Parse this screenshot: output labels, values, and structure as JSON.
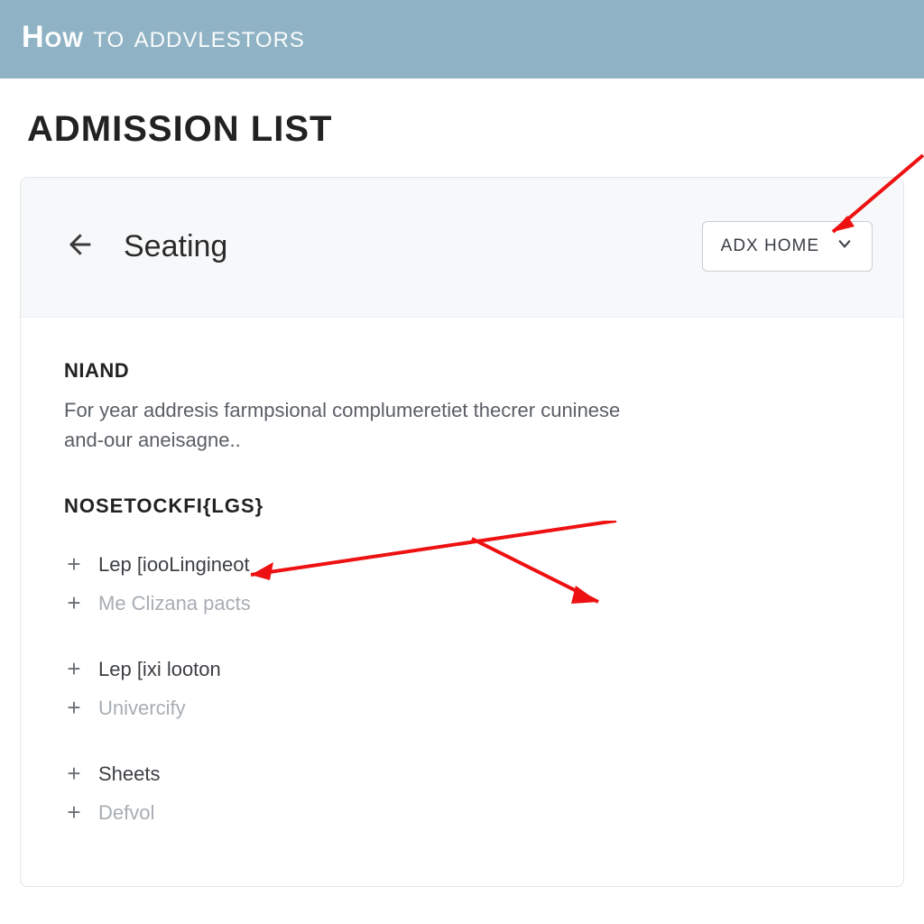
{
  "banner": {
    "lead": "How",
    "rest": " to addvlestors"
  },
  "page_title": "ADMISSION LIST",
  "card": {
    "back_icon": "arrow-left-icon",
    "title": "Seating",
    "dropdown": {
      "label": "ADX HOME",
      "chevron_icon": "chevron-down-icon"
    }
  },
  "section": {
    "label": "NIAND",
    "description": "For year addresis farmpsional complumeretiet thecrer cuninese and-our aneisagne..",
    "subheading": "NOSETOCKFI{LGS}"
  },
  "groups": [
    {
      "items": [
        {
          "label": "Lep [iooLingineot",
          "muted": false
        },
        {
          "label": "Me Clizana pacts",
          "muted": true
        }
      ]
    },
    {
      "items": [
        {
          "label": "Lep [ixi looton",
          "muted": false
        },
        {
          "label": "Univercify",
          "muted": true
        }
      ]
    },
    {
      "items": [
        {
          "label": "Sheets",
          "muted": false
        },
        {
          "label": "Defvol",
          "muted": true
        }
      ]
    }
  ]
}
